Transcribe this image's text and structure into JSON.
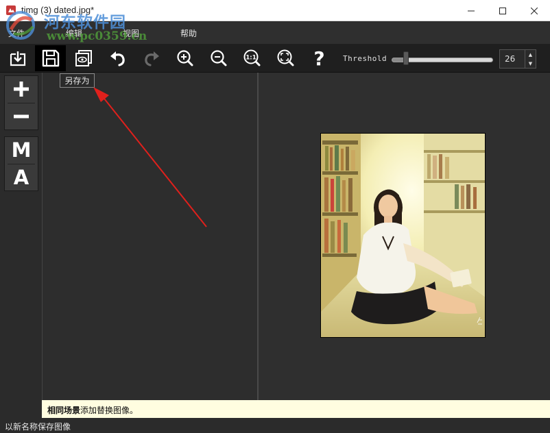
{
  "window": {
    "title": "timg (3) dated.jpg*",
    "controls": {
      "minimize_icon": "minimize-icon",
      "maximize_icon": "maximize-icon",
      "close_icon": "close-icon"
    }
  },
  "watermark": {
    "site_name": "河东软件园",
    "url": "www.pc0359.cn"
  },
  "menu": {
    "items": [
      {
        "label": "文件"
      },
      {
        "label": "编辑"
      },
      {
        "label": "视图"
      },
      {
        "label": "帮助"
      }
    ]
  },
  "toolbar": {
    "buttons": [
      {
        "icon": "import-icon"
      },
      {
        "icon": "save-icon"
      },
      {
        "icon": "preview-icon"
      },
      {
        "icon": "undo-icon"
      },
      {
        "icon": "redo-icon"
      },
      {
        "icon": "zoom-in-icon"
      },
      {
        "icon": "zoom-out-icon"
      },
      {
        "icon": "actual-size-icon",
        "text": "1:1"
      },
      {
        "icon": "fit-screen-icon"
      },
      {
        "icon": "help-icon",
        "text": "?"
      }
    ],
    "threshold": {
      "label": "Threshold",
      "value": "26",
      "level": 0.13
    }
  },
  "tooltip": {
    "text": "另存为"
  },
  "side_tools": {
    "zoom": [
      {
        "icon": "plus-icon"
      },
      {
        "icon": "minus-icon"
      }
    ],
    "modes": [
      {
        "label": "M"
      },
      {
        "label": "A"
      }
    ]
  },
  "info_strip": {
    "bold": "相同场景",
    "text": "添加替换图像。"
  },
  "status": {
    "text": "以新名称保存图像"
  },
  "colors": {
    "annotation_arrow": "#e0201c",
    "info_background": "#fffde0",
    "toolbar_background": "#1f1f1f"
  }
}
